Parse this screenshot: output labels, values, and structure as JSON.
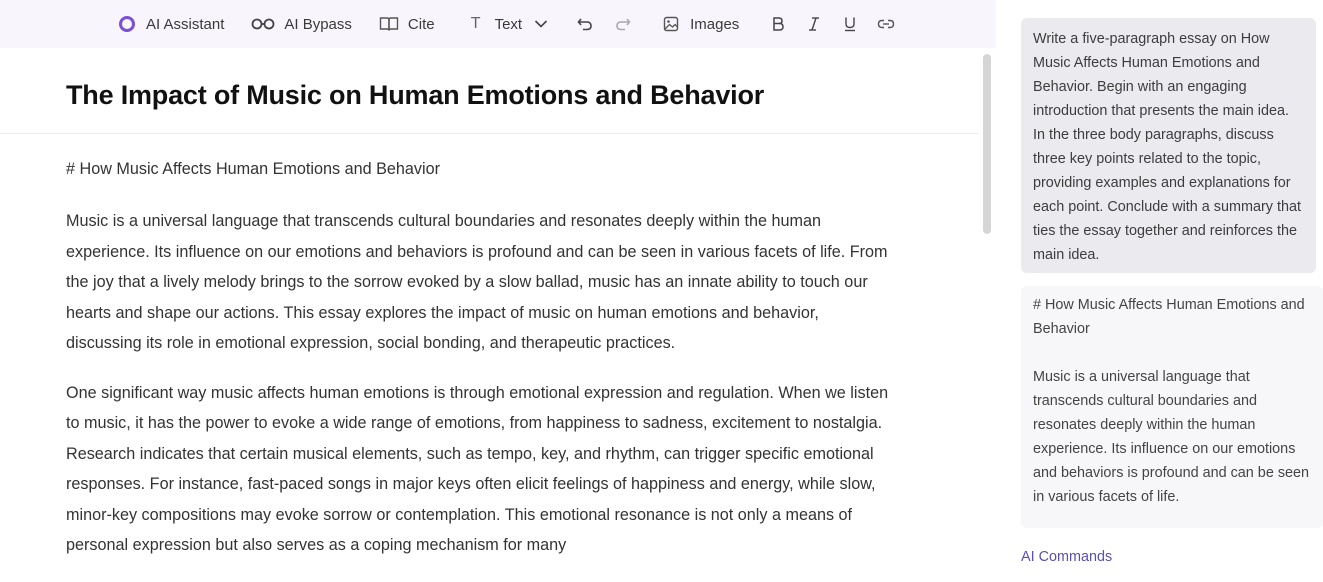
{
  "toolbar": {
    "ai_assistant": "AI Assistant",
    "ai_bypass": "AI Bypass",
    "cite": "Cite",
    "text": "Text",
    "images": "Images",
    "icon_colors": {
      "assistant_ring": "#7b4fd6"
    }
  },
  "document": {
    "title": "The Impact of Music on Human Emotions and Behavior",
    "heading": "# How Music Affects Human Emotions and Behavior",
    "paragraphs": [
      "Music is a universal language that transcends cultural boundaries and resonates deeply within the human experience. Its influence on our emotions and behaviors is profound and can be seen in various facets of life. From the joy that a lively melody brings to the sorrow evoked by a slow ballad, music has an innate ability to touch our hearts and shape our actions. This essay explores the impact of music on human emotions and behavior, discussing its role in emotional expression, social bonding, and therapeutic practices.",
      "One significant way music affects human emotions is through emotional expression and regulation. When we listen to music, it has the power to evoke a wide range of emotions, from happiness to sadness, excitement to nostalgia. Research indicates that certain musical elements, such as tempo, key, and rhythm, can trigger specific emotional responses. For instance, fast-paced songs in major keys often elicit feelings of happiness and energy, while slow, minor-key compositions may evoke sorrow or contemplation. This emotional resonance is not only a means of personal expression but also serves as a coping mechanism for many"
    ]
  },
  "sidebar": {
    "prompt": "Write a five-paragraph essay on How Music Affects Human Emotions and Behavior. Begin with an engaging introduction that presents the main idea. In the three body paragraphs, discuss three key points related to the topic, providing examples and explanations for each point. Conclude with a summary that ties the essay together and reinforces the main idea.",
    "response_heading": "# How Music Affects Human Emotions and Behavior",
    "response_text": "Music is a universal language that transcends cultural boundaries and resonates deeply within the human experience. Its influence on our emotions and behaviors is profound and can be seen in various facets of life.",
    "ai_commands": "AI Commands"
  }
}
